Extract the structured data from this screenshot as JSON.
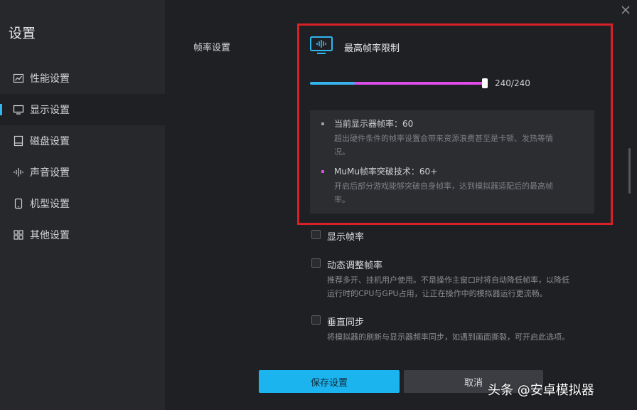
{
  "app": {
    "title": "设置"
  },
  "sidebar": {
    "items": [
      {
        "label": "性能设置",
        "icon": "chart-line-icon"
      },
      {
        "label": "显示设置",
        "icon": "monitor-icon"
      },
      {
        "label": "磁盘设置",
        "icon": "disk-icon"
      },
      {
        "label": "声音设置",
        "icon": "sound-wave-icon"
      },
      {
        "label": "机型设置",
        "icon": "phone-icon"
      },
      {
        "label": "其他设置",
        "icon": "grid-icon"
      }
    ],
    "active_index": 1
  },
  "section": {
    "label": "帧率设置"
  },
  "fps_limit": {
    "title": "最高帧率限制",
    "value_text": "240/240",
    "value": 240,
    "max": 240
  },
  "info": {
    "items": [
      {
        "title": "当前显示器帧率：60",
        "desc_line1": "超出硬件条件的帧率设置会带来资源浪费甚至是卡顿、发热等情",
        "desc_line2": "况。",
        "dot_color": "#9a9ca1"
      },
      {
        "title": "MuMu帧率突破技术：60+",
        "desc_line1": "开启后部分游戏能够突破自身帧率，达到模拟器适配后的最高帧",
        "desc_line2": "率。",
        "dot_color": "#d64fe6"
      }
    ]
  },
  "options": {
    "show_fps": {
      "label": "显示帧率",
      "checked": false
    },
    "dynamic_fps": {
      "label": "动态调整帧率",
      "checked": false,
      "desc_line1": "推荐多开、挂机用户使用。不是操作主窗口时将自动降低帧率，以降低",
      "desc_line2": "运行时的CPU与GPU占用，让正在操作中的模拟器运行更流畅。"
    },
    "vsync": {
      "label": "垂直同步",
      "checked": false,
      "desc_line1": "将模拟器的刷新与显示器频率同步，如遇到画面撕裂，可开启此选项。"
    }
  },
  "buttons": {
    "save": "保存设置",
    "cancel": "取消"
  },
  "watermark": {
    "text": "头条 @安卓模拟器"
  },
  "colors": {
    "accent": "#1cb4ee",
    "slider_pink": "#e44be8",
    "highlight": "#d82027",
    "background": "#1f2023",
    "sidebar": "#26282c"
  }
}
